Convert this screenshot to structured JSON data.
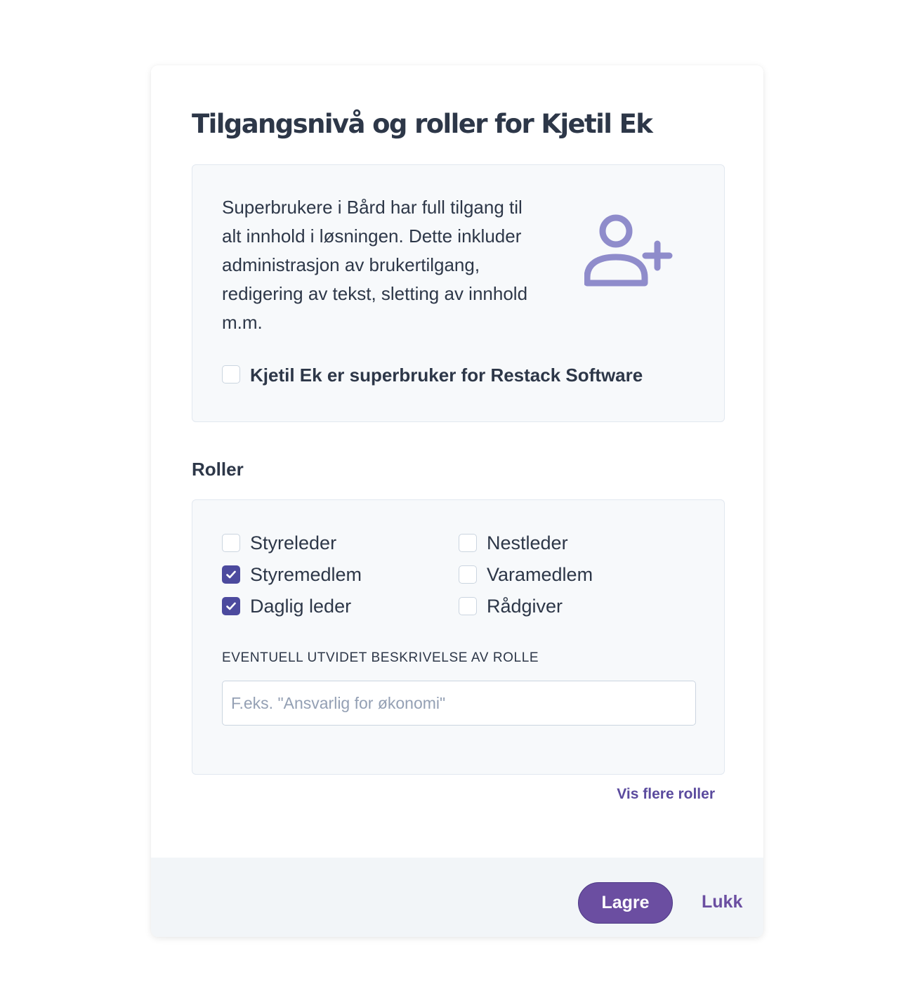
{
  "dialog": {
    "title": "Tilgangsnivå og roller for Kjetil Ek"
  },
  "superuser": {
    "description": "Superbrukere i Bård har full tilgang til alt innhold i løsningen. Dette inkluder administrasjon av brukertilgang, redigering av tekst, sletting av innhold m.m.",
    "icon": "user-plus-icon",
    "checkbox_label": "Kjetil Ek er superbruker for Restack Software",
    "checked": false
  },
  "roles": {
    "heading": "Roller",
    "items": [
      {
        "label": "Styreleder",
        "checked": false
      },
      {
        "label": "Nestleder",
        "checked": false
      },
      {
        "label": "Styremedlem",
        "checked": true
      },
      {
        "label": "Varamedlem",
        "checked": false
      },
      {
        "label": "Daglig leder",
        "checked": true
      },
      {
        "label": "Rådgiver",
        "checked": false
      }
    ],
    "description_label": "EVENTUELL UTVIDET BESKRIVELSE AV ROLLE",
    "description_value": "",
    "description_placeholder": "F.eks. \"Ansvarlig for økonomi\"",
    "more_link": "Vis flere roller"
  },
  "footer": {
    "save_label": "Lagre",
    "close_label": "Lukk"
  },
  "colors": {
    "accent": "#6b4ea1",
    "checkbox_checked": "#4c4a9e",
    "icon": "#8f8ccb",
    "panel_bg": "#f7f9fb",
    "footer_bg": "#f2f5f8"
  }
}
